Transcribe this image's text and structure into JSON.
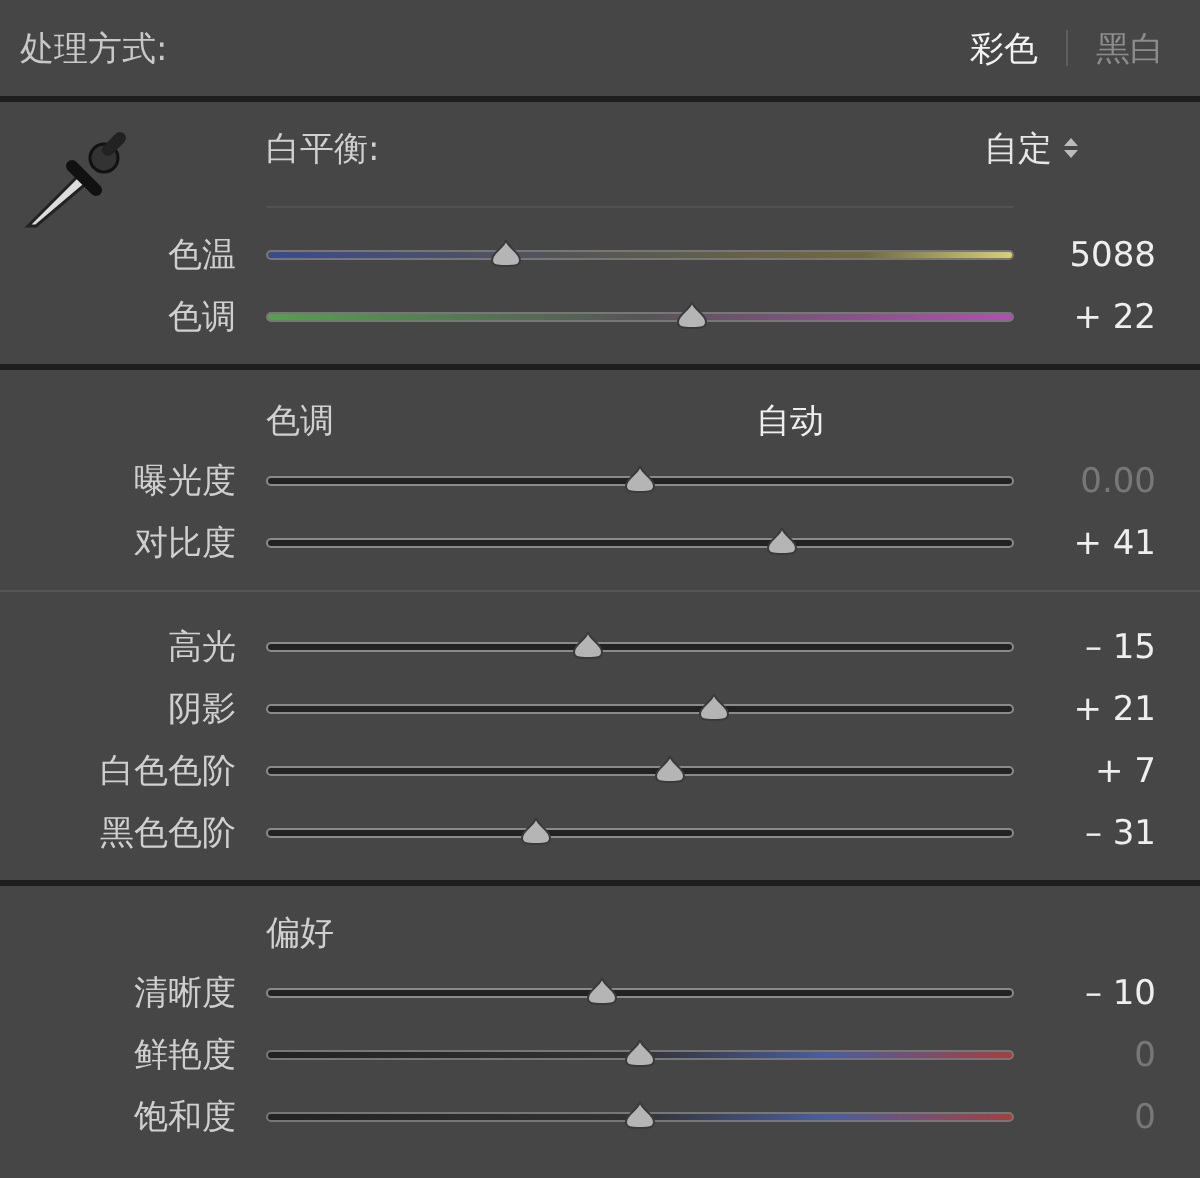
{
  "treatment": {
    "label": "处理方式:",
    "options": [
      {
        "label": "彩色",
        "selected": true
      },
      {
        "label": "黑白",
        "selected": false
      }
    ]
  },
  "white_balance": {
    "label": "白平衡:",
    "preset": "自定",
    "sliders": [
      {
        "kind": "temperature",
        "label": "色温",
        "level": 0.32,
        "reading": "5088",
        "at_default": false
      },
      {
        "kind": "tint",
        "label": "色调",
        "level": 0.57,
        "reading": "+ 22",
        "at_default": false
      }
    ]
  },
  "tone": {
    "label": "色调",
    "auto_button": "自动",
    "groups": [
      [
        {
          "kind": "plain",
          "label": "曝光度",
          "level": 0.5,
          "reading": "0.00",
          "at_default": true
        },
        {
          "kind": "plain",
          "label": "对比度",
          "level": 0.69,
          "reading": "+ 41",
          "at_default": false
        }
      ],
      [
        {
          "kind": "plain",
          "label": "高光",
          "level": 0.43,
          "reading": "– 15",
          "at_default": false
        },
        {
          "kind": "plain",
          "label": "阴影",
          "level": 0.6,
          "reading": "+ 21",
          "at_default": false
        },
        {
          "kind": "plain",
          "label": "白色色阶",
          "level": 0.54,
          "reading": "+ 7",
          "at_default": false
        },
        {
          "kind": "plain",
          "label": "黑色色阶",
          "level": 0.36,
          "reading": "– 31",
          "at_default": false
        }
      ]
    ]
  },
  "presence": {
    "label": "偏好",
    "sliders": [
      {
        "kind": "plain",
        "label": "清晰度",
        "level": 0.45,
        "reading": "– 10",
        "at_default": false
      },
      {
        "kind": "color",
        "label": "鲜艳度",
        "level": 0.5,
        "reading": "0",
        "at_default": true
      },
      {
        "kind": "color",
        "label": "饱和度",
        "level": 0.5,
        "reading": "0",
        "at_default": true
      }
    ]
  }
}
